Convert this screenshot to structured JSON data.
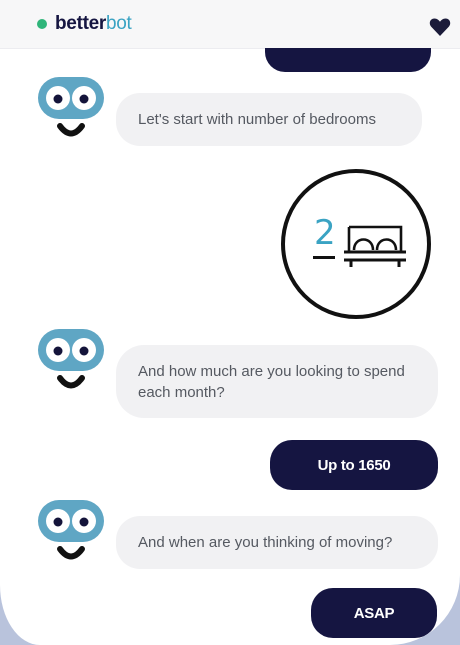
{
  "header": {
    "brand_bold": "better",
    "brand_light": "bot",
    "status_color": "#2fb57a",
    "icon": "heart-icon"
  },
  "colors": {
    "navy": "#151541",
    "bot_bubble": "#f1f1f3",
    "accent_blue": "#3aa3c3",
    "avatar_blue": "#5fa6c4"
  },
  "messages": [
    {
      "from": "bot",
      "text": "Let's start with number of bedrooms"
    },
    {
      "from": "user",
      "type": "bedroom-selection",
      "value": "2",
      "icon": "bed-icon"
    },
    {
      "from": "bot",
      "text": "And how much are you looking to spend each month?"
    },
    {
      "from": "user",
      "text": "Up to 1650"
    },
    {
      "from": "bot",
      "text": "And when are you thinking of moving?"
    },
    {
      "from": "user",
      "text": "ASAP"
    }
  ]
}
